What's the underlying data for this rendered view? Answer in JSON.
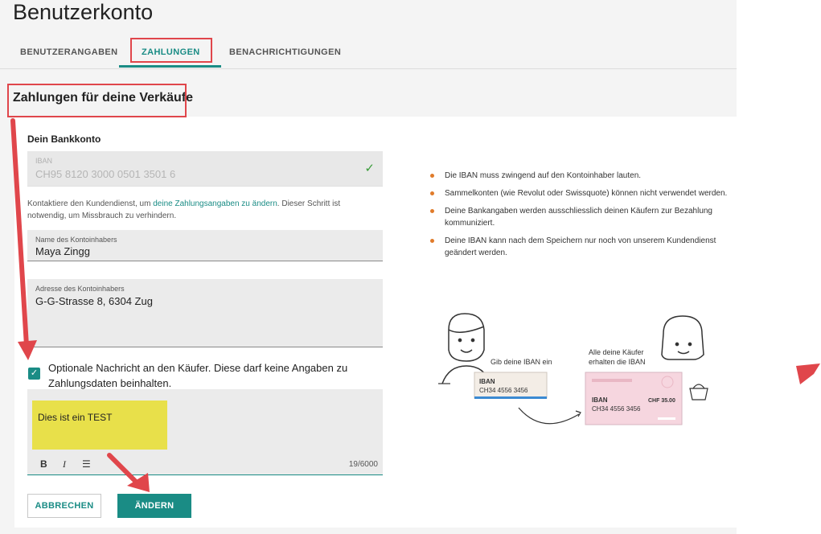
{
  "page": {
    "title": "Benutzerkonto"
  },
  "tabs": [
    {
      "label": "BENUTZERANGABEN",
      "active": false
    },
    {
      "label": "ZAHLUNGEN",
      "active": true
    },
    {
      "label": "BENACHRICHTIGUNGEN",
      "active": false
    }
  ],
  "section": {
    "title": "Zahlungen für deine Verkäufe"
  },
  "bank": {
    "heading": "Dein Bankkonto",
    "iban_label": "IBAN",
    "iban_value": "CH95 8120 3000 0501 3501 6",
    "help_pre": "Kontaktiere den Kundendienst, um ",
    "help_link": "deine Zahlungsangaben zu ändern",
    "help_post": ". Dieser Schritt ist notwendig, um Missbrauch zu verhindern.",
    "holder_label": "Name des Kontoinhabers",
    "holder_value": "Maya Zingg",
    "address_label": "Adresse des Kontoinhabers",
    "address_value": "G-G-Strasse 8, 6304 Zug"
  },
  "optional": {
    "checked": true,
    "label": "Optionale Nachricht an den Käufer. Diese darf keine Angaben zu Zahlungsdaten beinhalten.",
    "text": "Dies ist ein TEST",
    "counter": "19/6000"
  },
  "toolbar": {
    "bold": "B",
    "italic": "I",
    "list": "☰"
  },
  "buttons": {
    "cancel": "ABBRECHEN",
    "save": "ÄNDERN"
  },
  "info": [
    "Die IBAN muss zwingend auf den Kontoinhaber lauten.",
    "Sammelkonten (wie Revolut oder Swissquote) können nicht verwendet werden.",
    "Deine Bankangaben werden ausschliesslich deinen Käufern zur Bezahlung kommuniziert.",
    "Deine IBAN kann nach dem Speichern nur noch von unserem Kundendienst geändert werden."
  ],
  "illustration": {
    "caption_left": "Gib deine IBAN ein",
    "caption_right_1": "Alle deine Käufer",
    "caption_right_2": "erhalten die IBAN",
    "card_left_title": "IBAN",
    "card_left_number": "CH34 4556 3456",
    "card_right_title": "IBAN",
    "card_right_amount": "CHF 35.00",
    "card_right_number": "CH34 4556 3456"
  },
  "colors": {
    "accent": "#1a8c85",
    "annotation": "#e0464b",
    "bullet": "#e07b2a",
    "highlight": "#e8e04a"
  }
}
